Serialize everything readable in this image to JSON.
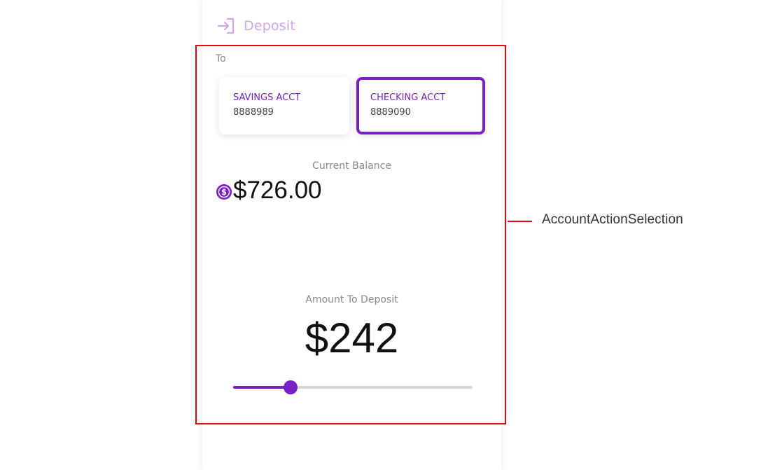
{
  "header": {
    "title": "Deposit",
    "icon": "login-arrow-icon"
  },
  "form": {
    "to_label": "To",
    "accounts": [
      {
        "name": "SAVINGS ACCT",
        "number": "8888989",
        "selected": false
      },
      {
        "name": "CHECKING ACCT",
        "number": "8889090",
        "selected": true
      }
    ],
    "balance": {
      "label": "Current Balance",
      "value": "$726.00",
      "icon": "dollar-circle-icon"
    },
    "deposit": {
      "label": "Amount To Deposit",
      "value": "$242",
      "slider_fraction": 0.24
    }
  },
  "annotation": {
    "label": "AccountActionSelection"
  },
  "colors": {
    "accent": "#7a1ec7",
    "accent_light": "#ceabe6",
    "highlight": "#e30613",
    "track": "#d6d6d6"
  }
}
